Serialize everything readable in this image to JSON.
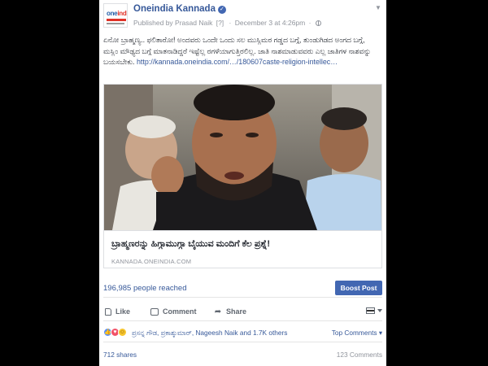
{
  "page": {
    "name": "Oneindia Kannada",
    "avatar_text_one": "one",
    "avatar_text_india": "india",
    "published_by": "Published by Prasad Naik",
    "published_marker": "[?]",
    "date": "December 3 at 4:26pm",
    "verified_icon": "check-badge-icon",
    "audience_icon": "globe-icon"
  },
  "post": {
    "text": "ಏನೋ ಬ್ರಾಹ್ಮಣ್ಯ.. ಫಲಿತಾರೋ! ಅಂದವರು ಒಂದೇ ಒಂದು ಸಲ ಮುಸ್ಲಿಮರ ಗಡ್ಡದ ಬಗ್ಗೆ, ತುಂಡುಗಿಡದ ಅಂಗದ ಬಗ್ಗೆ, ಮಸ್ಲಿಂ ಮೌಢ್ಯದ ಬಗ್ಗೆ ಮಾತನಾಡಿದ್ದರೆ ಇಷ್ಟೆಲ್ಲ ರಗಳೆಯಾಗುತ್ತಿರಲಿಲ್ಲ. ಜಾತಿ ನಾಶಮಾಡುವವರು ಎಲ್ಲ ಜಾತಿಗಳ ನಾಶವನ್ನು ಬಯಸಬೇಕು.",
    "link": "http://kannada.oneindia.com/…/180607caste-religion-intellec…"
  },
  "card": {
    "title": "ಬ್ರಾಹ್ಮಣರನ್ನು ಹಿಗ್ಗಾಮುಗ್ಗಾ ಬೈಯುವ ಮಂದಿಗೆ ಕೆಲ ಪ್ರಶ್ನೆ!",
    "domain": "KANNADA.ONEINDIA.COM"
  },
  "insights": {
    "reached": "196,985 people reached",
    "boost_label": "Boost Post"
  },
  "actions": {
    "like": "Like",
    "comment": "Comment",
    "share": "Share"
  },
  "reactions": {
    "names": "ಪ್ರಸನ್ನ ಗೌಡ, ಪ್ರಕಾಶ್ಕುಮಾರ್, Nageesh Naik and 1.7K others",
    "top_comments": "Top Comments ▾",
    "icons": [
      "like-reaction-icon",
      "love-reaction-icon",
      "haha-reaction-icon"
    ]
  },
  "counts": {
    "shares": "712 shares",
    "comments": "123 Comments"
  },
  "colors": {
    "brand_blue": "#365899",
    "button_blue": "#4267b2",
    "meta_gray": "#90949c"
  }
}
